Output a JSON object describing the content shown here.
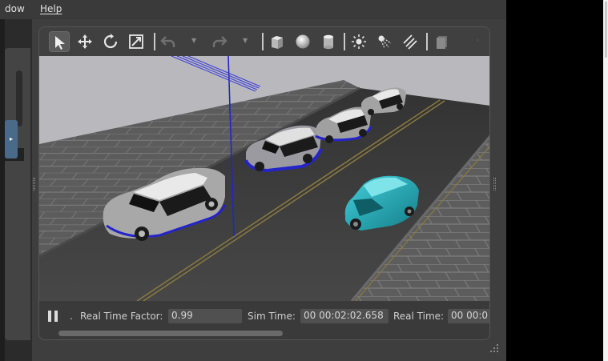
{
  "menubar": {
    "items": [
      "dow",
      "Help"
    ]
  },
  "toolbar": {
    "tools": [
      "select-arrow-icon",
      "translate-icon",
      "rotate-icon",
      "scale-icon",
      "undo-icon",
      "redo-icon",
      "box-icon",
      "sphere-icon",
      "cylinder-icon",
      "point-light-icon",
      "spot-light-icon",
      "directional-light-icon",
      "copy-icon"
    ],
    "active_tool": "select-arrow-icon"
  },
  "viewport": {
    "sky_color": "#b9b9bd",
    "road_color": "#3b3b3b",
    "sidewalk_color": "#5a5a5a",
    "highlight_color": "#2424c8",
    "selected_car_color": "#22b6c3"
  },
  "status": {
    "real_time_factor_label": "Real Time Factor:",
    "real_time_factor_value": "0.99",
    "sim_time_label": "Sim Time:",
    "sim_time_value": "00 00:02:02.658",
    "real_time_label": "Real Time:",
    "real_time_value": "00 00:0"
  }
}
